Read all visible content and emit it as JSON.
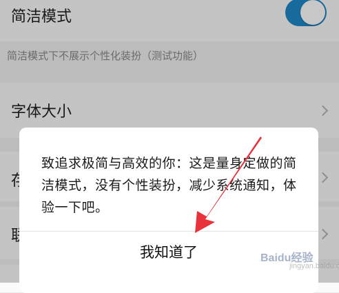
{
  "settings": {
    "simple_mode": {
      "label": "简洁模式",
      "toggle_on": true
    },
    "hint": "简洁模式下不展示个性化装扮（测试功能）",
    "font_size": {
      "label": "字体大小"
    },
    "partial_row_a": "存",
    "partial_row_b": "联"
  },
  "dialog": {
    "message": "致追求极简与高效的你：这是量身定做的简洁模式，没有个性装扮，减少系统通知，体验一下吧。",
    "ok_label": "我知道了"
  },
  "watermark": {
    "text": "Baidu经验",
    "sub": "jingyan.baidu.com"
  },
  "colors": {
    "accent": "#1e88c8",
    "arrow": "#e8323c"
  }
}
